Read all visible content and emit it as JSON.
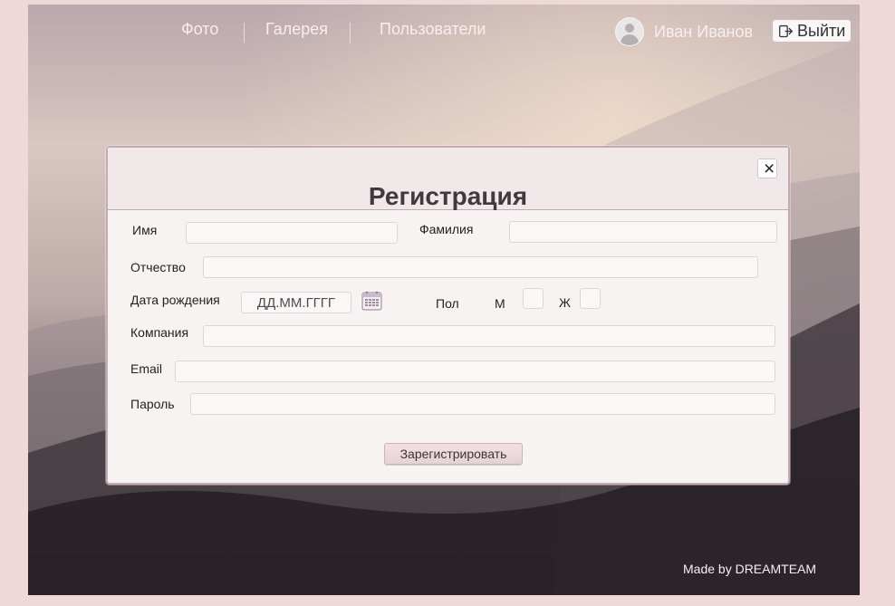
{
  "nav": {
    "items": [
      {
        "label": "Фото"
      },
      {
        "label": "Галерея"
      },
      {
        "label": "Пользователи"
      }
    ]
  },
  "user": {
    "name": "Иван Иванов",
    "logout_label": "Выйти",
    "avatar_icon": "user-avatar-icon",
    "logout_icon": "logout-icon"
  },
  "registration": {
    "title": "Регистрация",
    "close_label": "×",
    "fields": {
      "first_name_label": "Имя",
      "last_name_label": "Фамилия",
      "middle_name_label": "Отчество",
      "birth_date_label": "Дата рождения",
      "birth_date_placeholder": "ДД.ММ.ГГГГ",
      "gender_label": "Пол",
      "gender_male_label": "М",
      "gender_female_label": "Ж",
      "company_label": "Компания",
      "email_label": "Email",
      "password_label": "Пароль"
    },
    "submit_label": "Зарегистрировать"
  },
  "footer": {
    "credit": "Made by DREAMTEAM"
  },
  "icons": {
    "close": "close-icon",
    "calendar": "calendar-icon"
  },
  "colors": {
    "page_background": "#efd8d8",
    "modal_border": "#c6a9b1",
    "button_background": "#e6d2d4"
  }
}
